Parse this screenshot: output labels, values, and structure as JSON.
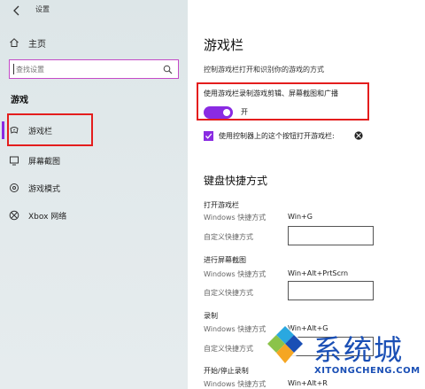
{
  "window": {
    "title": "设置"
  },
  "sidebar": {
    "home": "主页",
    "search_placeholder": "查找设置",
    "section": "游戏",
    "items": [
      {
        "label": "游戏栏",
        "icon": "gamebar-icon",
        "active": true
      },
      {
        "label": "屏幕截图",
        "icon": "screenshot-icon"
      },
      {
        "label": "游戏模式",
        "icon": "gamemode-icon"
      },
      {
        "label": "Xbox 网络",
        "icon": "xbox-icon"
      }
    ]
  },
  "main": {
    "title": "游戏栏",
    "description": "控制游戏栏打开和识别你的游戏的方式",
    "toggle": {
      "label": "使用游戏栏录制游戏剪辑、屏幕截图和广播",
      "state": "开",
      "on": true
    },
    "checkbox": {
      "label": "使用控制器上的这个按钮打开游戏栏:",
      "checked": true
    },
    "shortcuts_title": "键盘快捷方式",
    "shortcuts": [
      {
        "title": "打开游戏栏",
        "windows_label": "Windows 快捷方式",
        "windows_value": "Win+G",
        "custom_label": "自定义快捷方式"
      },
      {
        "title": "进行屏幕截图",
        "windows_label": "Windows 快捷方式",
        "windows_value": "Win+Alt+PrtScrn",
        "custom_label": "自定义快捷方式"
      },
      {
        "title": "录制",
        "windows_label": "Windows 快捷方式",
        "windows_value": "Win+Alt+G",
        "custom_label": "自定义快捷方式"
      },
      {
        "title": "开始/停止录制",
        "windows_label": "Windows 快捷方式",
        "windows_value": "Win+Alt+R"
      }
    ]
  },
  "watermark": {
    "text": "系统城",
    "sub": "XITONGCHENG.COM"
  },
  "colors": {
    "accent": "#8a2be2",
    "highlight": "#e41d1d",
    "watermark": "#1a4fb5"
  }
}
